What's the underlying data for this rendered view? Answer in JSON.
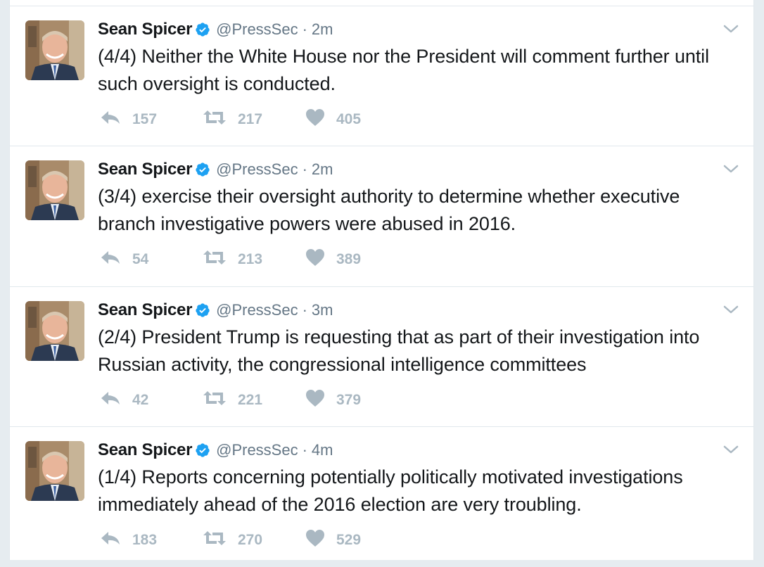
{
  "tweets": [
    {
      "name": "Sean Spicer",
      "handle": "@PressSec",
      "separator": "·",
      "time": "2m",
      "text": "(4/4) Neither the White House nor the President will comment further until such oversight is conducted.",
      "replies": "157",
      "retweets": "217",
      "likes": "405"
    },
    {
      "name": "Sean Spicer",
      "handle": "@PressSec",
      "separator": "·",
      "time": "2m",
      "text": "(3/4) exercise their oversight authority to determine whether executive branch investigative powers were abused in 2016.",
      "replies": "54",
      "retweets": "213",
      "likes": "389"
    },
    {
      "name": "Sean Spicer",
      "handle": "@PressSec",
      "separator": "·",
      "time": "3m",
      "text": "(2/4) President Trump is requesting that as part of their investigation into Russian activity, the congressional intelligence committees",
      "replies": "42",
      "retweets": "221",
      "likes": "379"
    },
    {
      "name": "Sean Spicer",
      "handle": "@PressSec",
      "separator": "·",
      "time": "4m",
      "text": "(1/4) Reports concerning potentially politically motivated investigations immediately ahead of the 2016 election are very troubling.",
      "replies": "183",
      "retweets": "270",
      "likes": "529"
    }
  ],
  "colors": {
    "verified": "#1da1f2",
    "action_icon": "#aab8c2",
    "handle": "#657786",
    "text": "#14171a"
  },
  "icons": {
    "verified": "verified-badge-icon",
    "menu": "chevron-down-icon",
    "reply": "reply-icon",
    "retweet": "retweet-icon",
    "like": "heart-icon"
  }
}
